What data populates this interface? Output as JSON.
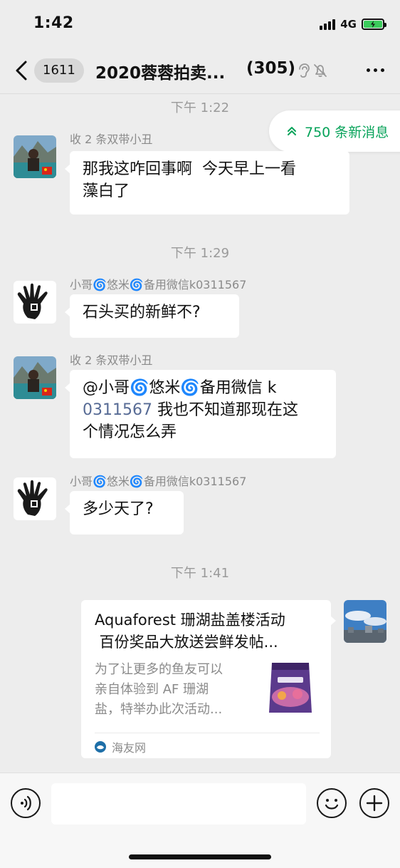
{
  "status_bar": {
    "time": "1:42",
    "network": "4G"
  },
  "nav": {
    "back_count": "1611",
    "title": "2020蓉蓉拍卖...",
    "member_count": "(305)"
  },
  "new_messages_pill": "750 条新消息",
  "messages": [
    {
      "time": "下午 1:22"
    },
    {
      "sender": "收 2 条双带小丑",
      "lines": [
        "那我这咋回事啊  今天早上一看",
        "藻白了"
      ]
    },
    {
      "time": "下午 1:29"
    },
    {
      "sender": "小哥🌀悠米🌀备用微信k0311567",
      "lines": [
        "石头买的新鲜不?"
      ]
    },
    {
      "sender": "收 2 条双带小丑",
      "line1": "@小哥🌀悠米🌀备用微信 k",
      "line2_num": "0311567",
      "line2_rest": " 我也不知道那现在这",
      "line3": "个情况怎么弄"
    },
    {
      "sender": "小哥🌀悠米🌀备用微信k0311567",
      "lines": [
        "多少天了?"
      ]
    },
    {
      "time": "下午 1:41"
    }
  ],
  "link_card": {
    "title_lines": [
      "Aquaforest 珊湖盐盖楼活动",
      " 百份奖品大放送尝鲜发帖..."
    ],
    "desc_lines": [
      "为了让更多的鱼友可以",
      "亲自体验到 AF 珊湖",
      "盐，特举办此次活动..."
    ],
    "source": "海友网"
  },
  "colors": {
    "background": "#EDEDED",
    "accent_green": "#07A35A",
    "mention_blue": "#576B95"
  }
}
